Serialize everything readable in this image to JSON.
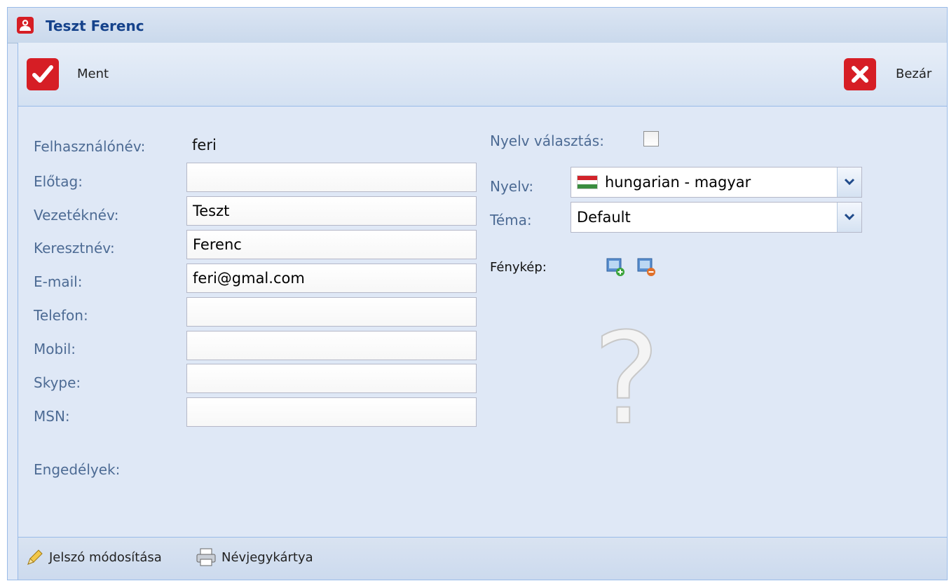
{
  "window": {
    "title": "Teszt Ferenc"
  },
  "toolbar": {
    "save_label": "Ment",
    "close_label": "Bezár"
  },
  "form": {
    "username": {
      "label": "Felhasználónév:",
      "value": "feri"
    },
    "prefix": {
      "label": "Előtag:",
      "value": ""
    },
    "lastname": {
      "label": "Vezetéknév:",
      "value": "Teszt"
    },
    "firstname": {
      "label": "Keresztnév:",
      "value": "Ferenc"
    },
    "email": {
      "label": "E-mail:",
      "value": "feri@gmal.com"
    },
    "phone": {
      "label": "Telefon:",
      "value": ""
    },
    "mobile": {
      "label": "Mobil:",
      "value": ""
    },
    "skype": {
      "label": "Skype:",
      "value": ""
    },
    "msn": {
      "label": "MSN:",
      "value": ""
    },
    "permissions": {
      "label": "Engedélyek:"
    },
    "language_select": {
      "label": "Nyelv választás:",
      "checked": false
    },
    "language": {
      "label": "Nyelv:",
      "value": "hungarian - magyar",
      "icon": "hungary-flag-icon"
    },
    "theme": {
      "label": "Téma:",
      "value": "Default"
    },
    "photo": {
      "label": "Fénykép:",
      "placeholder_icon": "question-mark-icon"
    }
  },
  "footer": {
    "change_password": "Jelszó módosítása",
    "business_card": "Névjegykártya"
  },
  "colors": {
    "accent_red": "#d61e25",
    "label_blue": "#4d6b94",
    "title_blue": "#15428b"
  }
}
